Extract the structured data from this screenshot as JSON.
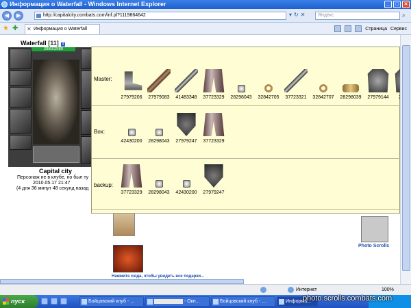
{
  "window": {
    "title": "Информация о Waterfall - Windows Internet Explorer"
  },
  "address": {
    "url": "http://capitalcity.combats.com/inf.pl?1119864642",
    "search_placeholder": "Яндекс"
  },
  "toolbar": {
    "tab_title": "Информация о Waterfall",
    "page_menu": "Страница",
    "tools_menu": "Сервис"
  },
  "character": {
    "name": "Waterfall",
    "level": "[11]",
    "hp": "2980/2980",
    "city": "Capital city",
    "status_line1": "Персонаж не в клубе, но был ту",
    "status_line2": "2010.05.17 21:47",
    "status_line3": "(4 дня 36 минут 48 секунд назад"
  },
  "sets": [
    {
      "label": "Master:",
      "items": [
        {
          "kind": "boots",
          "code": "27979206"
        },
        {
          "kind": "dagger",
          "code": "27979083"
        },
        {
          "kind": "sword",
          "code": "41483348"
        },
        {
          "kind": "pants",
          "code": "37723329"
        },
        {
          "kind": "small",
          "code": "28298043"
        },
        {
          "kind": "ring",
          "code": "32842705"
        },
        {
          "kind": "sword",
          "code": "37723321"
        },
        {
          "kind": "ring",
          "code": "32842707"
        },
        {
          "kind": "amulet",
          "code": "28298039"
        },
        {
          "kind": "armor",
          "code": "27979144"
        },
        {
          "kind": "armor",
          "code": "27979"
        }
      ]
    },
    {
      "label": "Box:",
      "items": [
        {
          "kind": "small",
          "code": "42430200"
        },
        {
          "kind": "small",
          "code": "28298043"
        },
        {
          "kind": "shield",
          "code": "27979247"
        },
        {
          "kind": "pants",
          "code": "37723329"
        }
      ]
    },
    {
      "label": "backup:",
      "items": [
        {
          "kind": "pants",
          "code": "37723329"
        },
        {
          "kind": "small",
          "code": "28298043"
        },
        {
          "kind": "small",
          "code": "42430200"
        },
        {
          "kind": "shield",
          "code": "27979247"
        }
      ]
    }
  ],
  "page": {
    "photo_label": "Photo Scrolls",
    "present_label": "Нажмите сюда, чтобы увидеть все подарки..."
  },
  "statusbar": {
    "zone": "Интернет",
    "zoom": "100%"
  },
  "taskbar": {
    "start_label": "пуск",
    "task1": "Бойцовский клуб - ...",
    "task2_suffix": "- Окн...",
    "task3": "Бойцовский клуб - ...",
    "task4": "Информа..."
  },
  "watermark": "photo.scrolls.combats.com"
}
